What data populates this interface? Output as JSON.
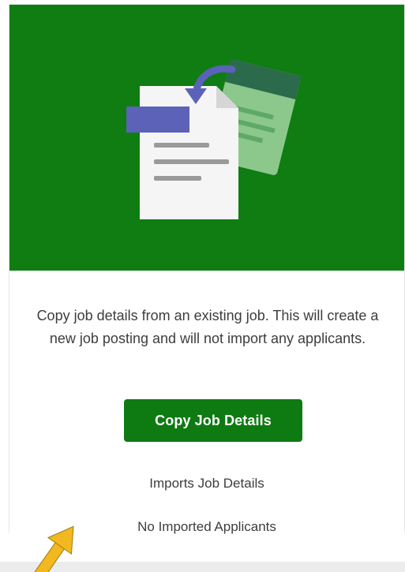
{
  "card": {
    "illustration": "copy-document-icon",
    "description": "Copy job details from an existing job. This will create a new job posting and will not import any applicants.",
    "button_label": "Copy Job Details",
    "features": [
      "Imports Job Details",
      "No Imported Applicants"
    ]
  },
  "annotation": {
    "arrow": "pointer-arrow-icon",
    "arrow_color": "#f2b81f"
  },
  "colors": {
    "brand_green": "#0f7d12",
    "text": "#3d3d3d",
    "illustration_purple": "#5b62b8",
    "illustration_light_green": "#8cc88c"
  }
}
